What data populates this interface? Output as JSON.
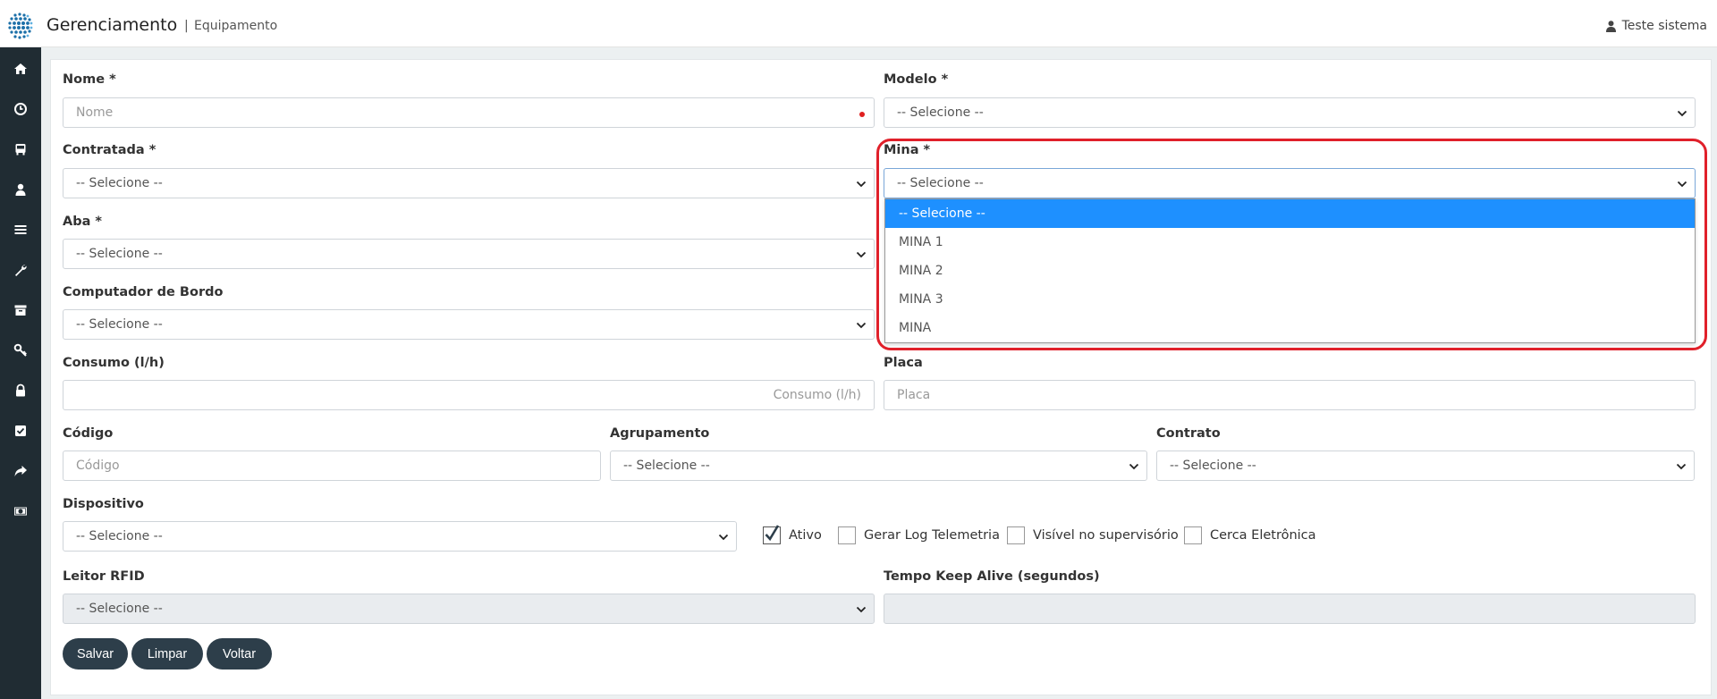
{
  "header": {
    "app_title": "Gerenciamento",
    "separator": "|",
    "breadcrumb": "Equipamento",
    "user_name": "Teste sistema"
  },
  "sidebar": {
    "items": [
      {
        "icon": "home-icon"
      },
      {
        "icon": "clock-icon"
      },
      {
        "icon": "bus-icon"
      },
      {
        "icon": "user-icon"
      },
      {
        "icon": "list-icon"
      },
      {
        "icon": "wrench-icon"
      },
      {
        "icon": "archive-icon"
      },
      {
        "icon": "key-icon"
      },
      {
        "icon": "lock-icon"
      },
      {
        "icon": "checkbox-icon"
      },
      {
        "icon": "share-icon"
      },
      {
        "icon": "money-icon"
      }
    ]
  },
  "form": {
    "nome": {
      "label": "Nome *",
      "placeholder": "Nome"
    },
    "modelo": {
      "label": "Modelo *",
      "value": "-- Selecione --"
    },
    "contratada": {
      "label": "Contratada *",
      "value": "-- Selecione --"
    },
    "mina": {
      "label": "Mina *",
      "value": "-- Selecione --",
      "options": [
        "-- Selecione --",
        "MINA 1",
        "MINA 2",
        "MINA 3",
        "MINA"
      ]
    },
    "aba": {
      "label": "Aba *",
      "value": "-- Selecione --"
    },
    "computador": {
      "label": "Computador de Bordo",
      "value": "-- Selecione --"
    },
    "consumo": {
      "label": "Consumo (l/h)",
      "placeholder": "Consumo (l/h)"
    },
    "placa": {
      "label": "Placa",
      "placeholder": "Placa"
    },
    "codigo": {
      "label": "Código",
      "placeholder": "Código"
    },
    "agrupamento": {
      "label": "Agrupamento",
      "value": "-- Selecione --"
    },
    "contrato": {
      "label": "Contrato",
      "value": "-- Selecione --"
    },
    "dispositivo": {
      "label": "Dispositivo",
      "value": "-- Selecione --"
    },
    "checkboxes": [
      {
        "label": "Ativo",
        "checked": true
      },
      {
        "label": "Gerar Log Telemetria",
        "checked": false
      },
      {
        "label": "Visível no supervisório",
        "checked": false
      },
      {
        "label": "Cerca Eletrônica",
        "checked": false
      }
    ],
    "leitor_rfid": {
      "label": "Leitor RFID",
      "value": "-- Selecione --"
    },
    "tempo_keep_alive": {
      "label": "Tempo Keep Alive (segundos)",
      "value": ""
    }
  },
  "buttons": {
    "salvar": "Salvar",
    "limpar": "Limpar",
    "voltar": "Voltar"
  },
  "colors": {
    "sidebar_bg": "#202c33",
    "button_bg": "#2d3e4a",
    "selected_option": "#1e90ff",
    "highlight": "#e0202a"
  }
}
